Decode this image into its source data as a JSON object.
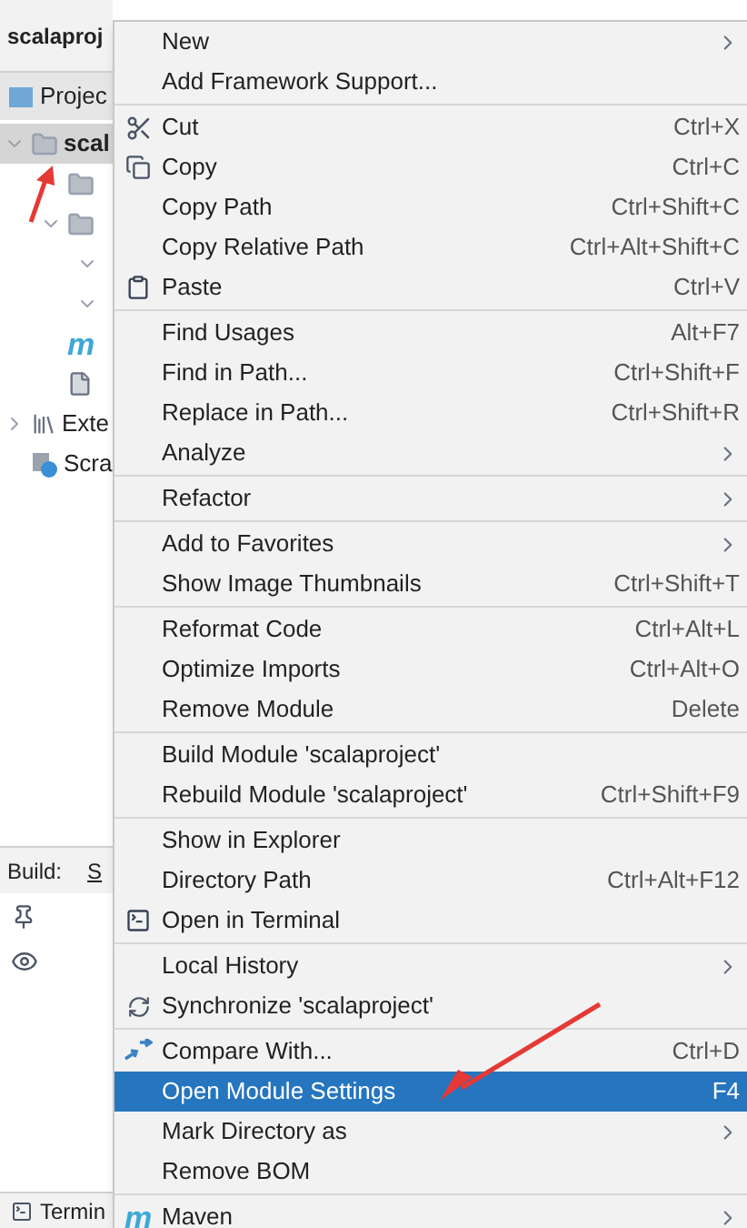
{
  "header": {
    "title": "scalaproj"
  },
  "project_tab": {
    "label": "Projec"
  },
  "tree": [
    {
      "label": "scal",
      "kind": "folder",
      "selected": true,
      "expanded": true,
      "children": [
        {
          "kind": "folder"
        },
        {
          "kind": "folder",
          "expanded": true,
          "children": [
            {
              "expanded": true
            },
            {
              "expanded": true
            }
          ]
        },
        {
          "kind": "maven",
          "glyph": "m"
        },
        {
          "kind": "file"
        }
      ]
    },
    {
      "label": "Exte",
      "kind": "library",
      "expanded": false
    },
    {
      "label": "Scra",
      "kind": "scratch"
    }
  ],
  "build_bar": {
    "label": "Build:",
    "tab": "S"
  },
  "bottom_bar": {
    "label": "Termin"
  },
  "menu": {
    "groups": [
      [
        {
          "label": "New",
          "submenu": true,
          "selected": false
        },
        {
          "label": "Add Framework Support...",
          "submenu": false,
          "selected": false
        }
      ],
      [
        {
          "label": "Cut",
          "kind": "scissors",
          "shortcut": "Ctrl+X",
          "submenu": false,
          "selected": false
        },
        {
          "label": "Copy",
          "kind": "copy",
          "shortcut": "Ctrl+C",
          "submenu": false,
          "selected": false
        },
        {
          "label": "Copy Path",
          "shortcut": "Ctrl+Shift+C",
          "submenu": false,
          "selected": false
        },
        {
          "label": "Copy Relative Path",
          "shortcut": "Ctrl+Alt+Shift+C",
          "submenu": false,
          "selected": false
        },
        {
          "label": "Paste",
          "kind": "paste",
          "shortcut": "Ctrl+V",
          "submenu": false,
          "selected": false
        }
      ],
      [
        {
          "label": "Find Usages",
          "shortcut": "Alt+F7",
          "submenu": false,
          "selected": false
        },
        {
          "label": "Find in Path...",
          "shortcut": "Ctrl+Shift+F",
          "submenu": false,
          "selected": false
        },
        {
          "label": "Replace in Path...",
          "shortcut": "Ctrl+Shift+R",
          "submenu": false,
          "selected": false
        },
        {
          "label": "Analyze",
          "submenu": true,
          "selected": false
        }
      ],
      [
        {
          "label": "Refactor",
          "submenu": true,
          "selected": false
        }
      ],
      [
        {
          "label": "Add to Favorites",
          "submenu": true,
          "selected": false
        },
        {
          "label": "Show Image Thumbnails",
          "shortcut": "Ctrl+Shift+T",
          "submenu": false,
          "selected": false
        }
      ],
      [
        {
          "label": "Reformat Code",
          "shortcut": "Ctrl+Alt+L",
          "submenu": false,
          "selected": false
        },
        {
          "label": "Optimize Imports",
          "shortcut": "Ctrl+Alt+O",
          "submenu": false,
          "selected": false
        },
        {
          "label": "Remove Module",
          "shortcut": "Delete",
          "submenu": false,
          "selected": false
        }
      ],
      [
        {
          "label": "Build Module 'scalaproject'",
          "submenu": false,
          "selected": false
        },
        {
          "label": "Rebuild Module 'scalaproject'",
          "shortcut": "Ctrl+Shift+F9",
          "submenu": false,
          "selected": false
        }
      ],
      [
        {
          "label": "Show in Explorer",
          "submenu": false,
          "selected": false
        },
        {
          "label": "Directory Path",
          "shortcut": "Ctrl+Alt+F12",
          "submenu": false,
          "selected": false
        },
        {
          "label": "Open in Terminal",
          "kind": "terminal",
          "submenu": false,
          "selected": false
        }
      ],
      [
        {
          "label": "Local History",
          "submenu": true,
          "selected": false
        },
        {
          "label": "Synchronize 'scalaproject'",
          "kind": "sync",
          "submenu": false,
          "selected": false
        }
      ],
      [
        {
          "label": "Compare With...",
          "kind": "compare",
          "shortcut": "Ctrl+D",
          "submenu": false,
          "selected": false
        },
        {
          "label": "Open Module Settings",
          "shortcut": "F4",
          "submenu": false,
          "selected": true
        },
        {
          "label": "Mark Directory as",
          "submenu": true,
          "selected": false
        },
        {
          "label": "Remove BOM",
          "submenu": false,
          "selected": false
        }
      ],
      [
        {
          "label": "Maven",
          "kind": "maven",
          "glyph": "m",
          "submenu": true,
          "selected": false
        }
      ]
    ]
  }
}
